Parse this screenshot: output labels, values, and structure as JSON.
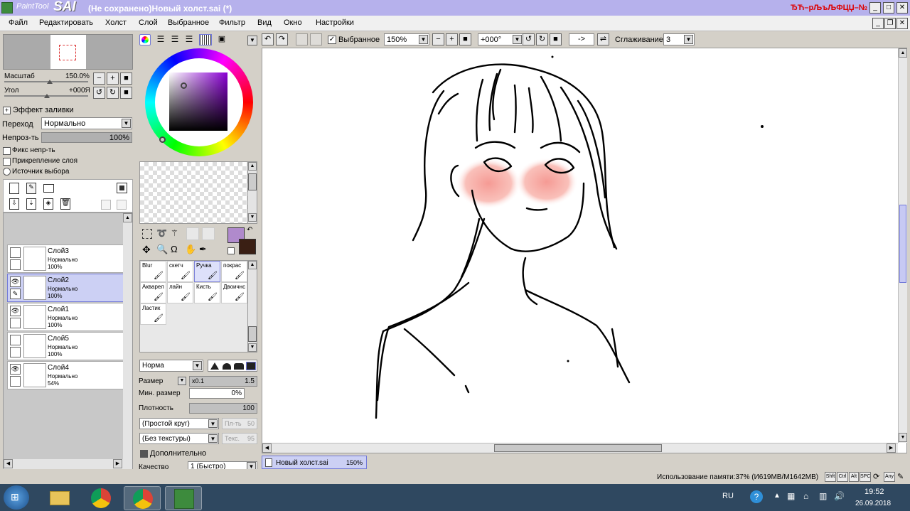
{
  "window": {
    "app_name_small": "PaintTool",
    "app_name_big": "SAI",
    "title": "(Не сохранено)Новый холст.sai (*)",
    "title_right": "ЂЋ–рЉъЉФЦЏ–№"
  },
  "menu": [
    "Файл",
    "Редактировать",
    "Холст",
    "Слой",
    "Выбранное",
    "Фильтр",
    "Вид",
    "Окно",
    "Настройки"
  ],
  "navigator": {
    "scale_label": "Масштаб",
    "scale_value": "150.0%",
    "angle_label": "Угол",
    "angle_value": "+000Я"
  },
  "fill": {
    "effect_label": "Эффект заливки",
    "mode_label": "Переход",
    "mode_value": "Нормально",
    "opacity_label": "Непроз-ть",
    "opacity_value": "100%",
    "opacity_fraction": 1.0
  },
  "checks": [
    {
      "label": "Фикс непр-ть",
      "type": "checkbox"
    },
    {
      "label": "Прикрепление слоя",
      "type": "checkbox"
    },
    {
      "label": "Источник выбора",
      "type": "radio"
    }
  ],
  "layers": [
    {
      "name": "Слой3",
      "mode": "Нормально",
      "opacity": "100%",
      "visible": false,
      "selected": false
    },
    {
      "name": "Слой2",
      "mode": "Нормально",
      "opacity": "100%",
      "visible": true,
      "selected": true
    },
    {
      "name": "Слой1",
      "mode": "Нормально",
      "opacity": "100%",
      "visible": true,
      "selected": false
    },
    {
      "name": "Слой5",
      "mode": "Нормально",
      "opacity": "100%",
      "visible": false,
      "selected": false
    },
    {
      "name": "Слой4",
      "mode": "Нормально",
      "opacity": "54%",
      "visible": true,
      "selected": false
    }
  ],
  "colors": {
    "primary": "#b08acc",
    "secondary": "#3a1f14",
    "accent": "#7279d8"
  },
  "tools": [
    {
      "name": "Blur"
    },
    {
      "name": "скетч"
    },
    {
      "name": "Ручка",
      "selected": true
    },
    {
      "name": "покрас"
    },
    {
      "name": "Акварел"
    },
    {
      "name": "лайн"
    },
    {
      "name": "Кисть"
    },
    {
      "name": "Двоичнс"
    },
    {
      "name": "Ластик"
    }
  ],
  "brush": {
    "blend_value": "Норма",
    "size_label": "Размер",
    "size_mult": "x0.1",
    "size_value": "1.5",
    "min_size_label": "Мин. размер",
    "min_size_value": "0%",
    "density_label": "Плотность",
    "density_value": "100",
    "shape_value": "(Простой круг)",
    "shape_param_label": "Пл-ть",
    "shape_param_value": "50",
    "texture_value": "(Без текстуры)",
    "texture_param_label": "Текс.",
    "texture_param_value": "95",
    "advanced_label": "Дополнительно",
    "quality_label": "Качество",
    "quality_value": "1 (Быстро)"
  },
  "toolbar": {
    "selection_label": "Выбранное",
    "zoom_value": "150%",
    "angle_value": "+000°",
    "flip_value": "->",
    "smooth_label": "Сглаживание",
    "smooth_value": "3"
  },
  "tab": {
    "name": "Новый холст.sai",
    "zoom": "150%"
  },
  "status": {
    "memory": "Использование памяти:37% (И619МВ/М1642МВ)",
    "keys": [
      "Shft",
      "Ctrl",
      "Alt",
      "SPC",
      "Any"
    ]
  },
  "taskbar": {
    "lang": "RU",
    "time": "19:52",
    "date": "26.09.2018"
  }
}
